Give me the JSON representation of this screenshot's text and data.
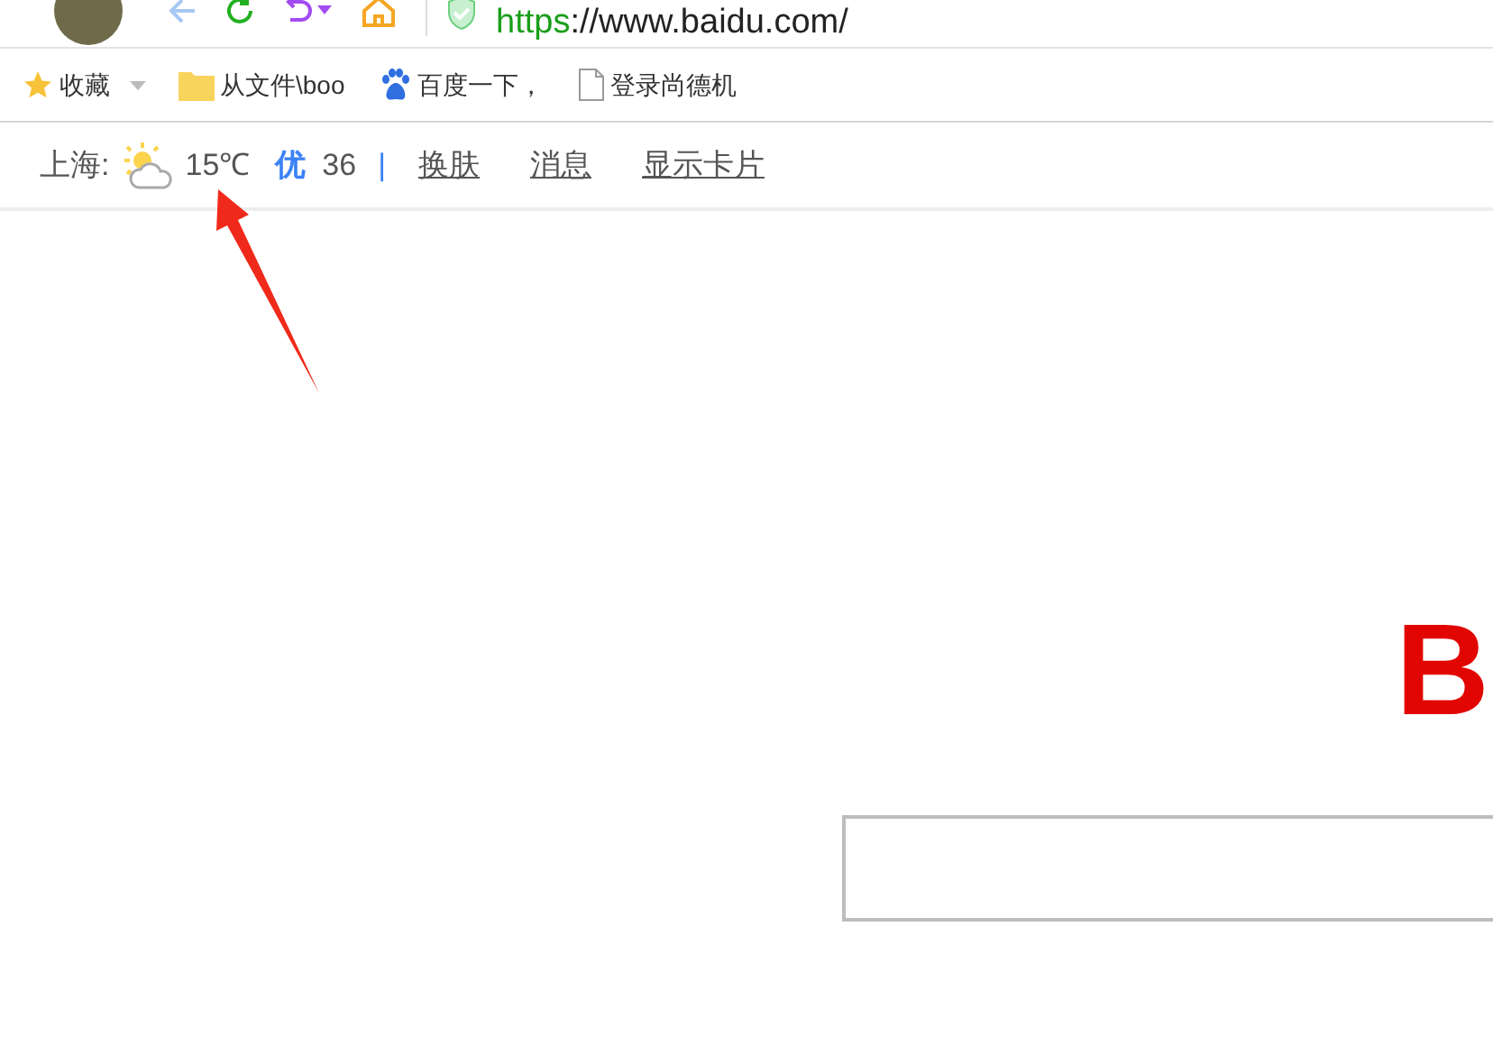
{
  "toolbar": {
    "url_scheme": "https",
    "url_rest": "://www.baidu.com/"
  },
  "bookmarks": [
    {
      "label": "收藏",
      "kind": "favorites"
    },
    {
      "label": "从文件\\boo",
      "kind": "folder"
    },
    {
      "label": "百度一下，",
      "kind": "baidu"
    },
    {
      "label": "登录尚德机",
      "kind": "page"
    }
  ],
  "weather": {
    "city": "上海:",
    "temperature": "15℃",
    "air_quality": "优",
    "aqi": "36",
    "separator": "|",
    "links": [
      "换肤",
      "消息",
      "显示卡片"
    ]
  },
  "logo": {
    "text": "B"
  }
}
